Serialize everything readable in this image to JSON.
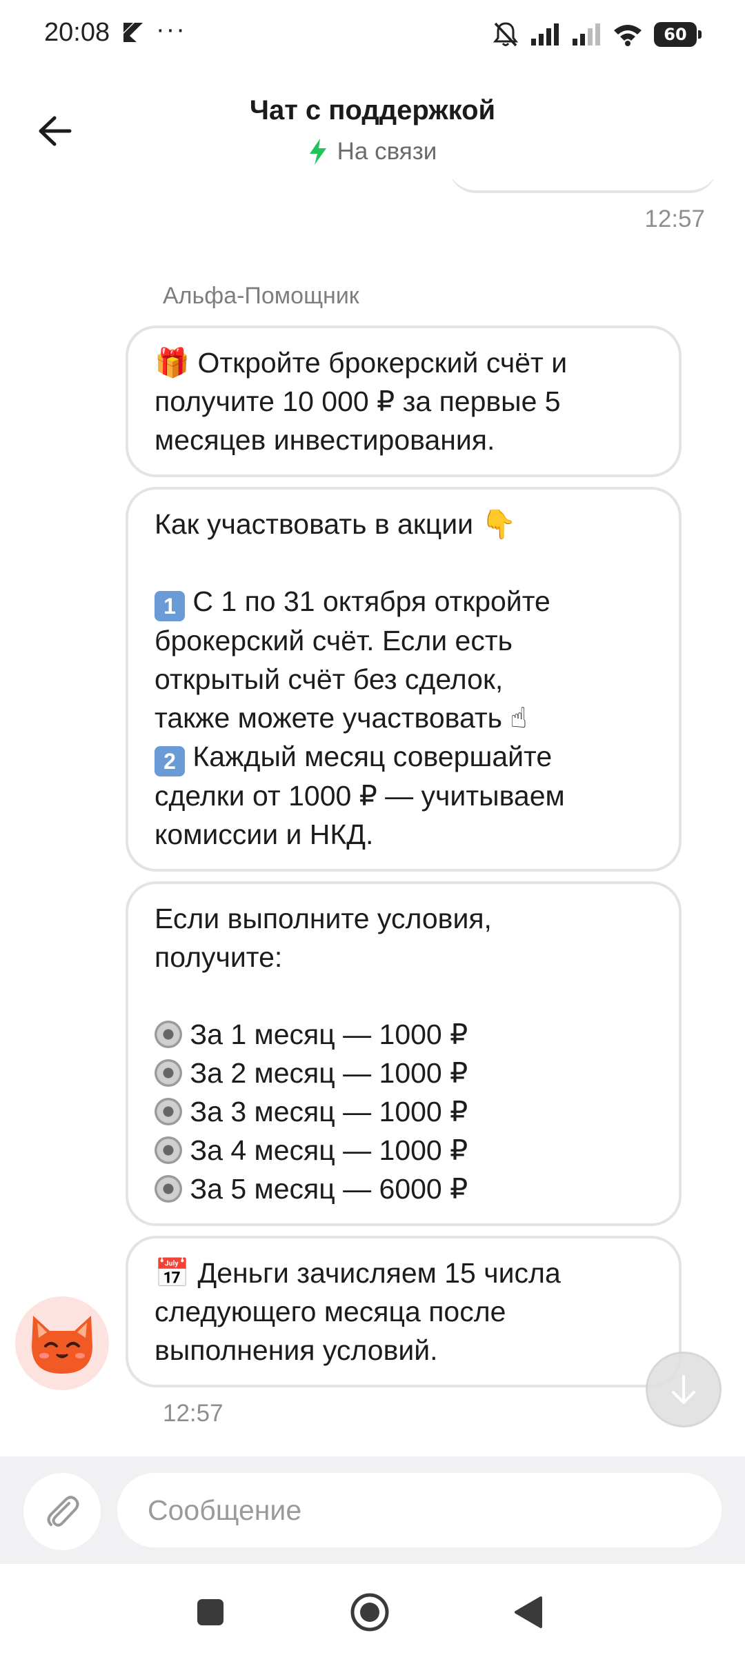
{
  "status_bar": {
    "time": "20:08",
    "dots": "···",
    "battery": "60"
  },
  "header": {
    "title": "Чат с поддержкой",
    "status": "На связи"
  },
  "chat": {
    "prev_time": "12:57",
    "sender": "Альфа-Помощник",
    "message1": {
      "emoji": "🎁",
      "lines": [
        "Откройте брокерский счёт и",
        "получите 10 000 ₽ за первые 5",
        "месяцев инвестирования."
      ]
    },
    "message2": {
      "heading": "Как участвовать в акции",
      "heading_emoji": "👇",
      "step1_key": "1",
      "step1_lines": [
        "С 1 по 31 октября откройте",
        "брокерский счёт. Если есть",
        "открытый счёт без сделок,",
        "также можете участвовать"
      ],
      "step1_emoji": "☝",
      "step2_key": "2",
      "step2_lines": [
        "Каждый месяц совершайте",
        "сделки от 1000 ₽ — учитываем",
        "комиссии и НКД."
      ]
    },
    "message3": {
      "intro": [
        "Если выполните условия,",
        "получите:"
      ],
      "items": [
        "За 1 месяц — 1000 ₽",
        "За 2 месяц — 1000 ₽",
        "За 3 месяц — 1000 ₽",
        "За 4 месяц — 1000 ₽",
        "За 5 месяц — 6000 ₽"
      ]
    },
    "message4": {
      "emoji": "📅",
      "lines": [
        "Деньги зачисляем 15 числа",
        "следующего месяца после",
        "выполнения условий."
      ]
    },
    "time": "12:57"
  },
  "input": {
    "placeholder": "Сообщение"
  },
  "colors": {
    "accent_green": "#21c45a",
    "bubble_border": "#e3e3e3",
    "avatar_bg": "#fde3e0"
  }
}
